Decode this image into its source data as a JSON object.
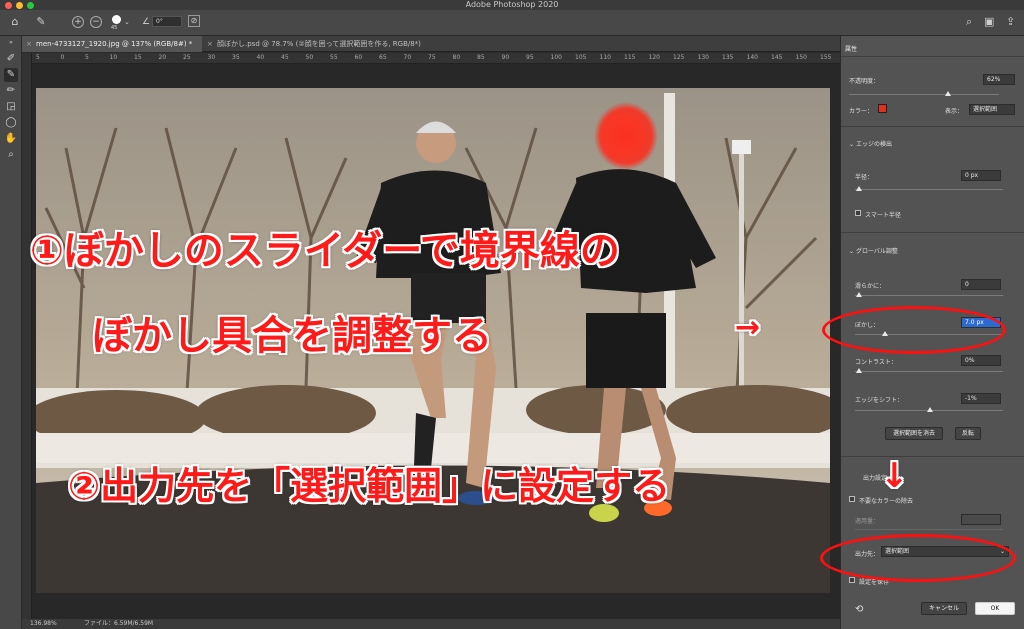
{
  "window": {
    "title": "Adobe Photoshop 2020"
  },
  "colors": {
    "accent_red": "#ff1a1a",
    "mask_red": "#e03020",
    "selection_blue": "#2b6ad0"
  },
  "options_bar": {
    "brush_size": "45",
    "angle": "0°"
  },
  "tabs": [
    {
      "label": "men-4733127_1920.jpg @ 137% (RGB/8#) *",
      "active": true
    },
    {
      "label": "顔ぼかし.psd @ 78.7% (②顔を囲って選択範囲を作る, RGB/8*)",
      "active": false
    }
  ],
  "ruler": {
    "ticks": [
      "5",
      "0",
      "5",
      "10",
      "15",
      "20",
      "25",
      "30",
      "35",
      "40",
      "45",
      "50",
      "55",
      "60",
      "65",
      "70",
      "75",
      "80",
      "85",
      "90",
      "95",
      "100",
      "105",
      "110",
      "115",
      "120",
      "125",
      "130",
      "135",
      "140",
      "145",
      "150",
      "155"
    ]
  },
  "status": {
    "zoom": "136.98%",
    "file": "ファイル：6.59M/6.59M"
  },
  "properties": {
    "tab": "属性",
    "opacity_label": "不透明度：",
    "opacity_value": "62%",
    "color_label": "カラー：",
    "view_label": "表示：",
    "view_value": "選択範囲",
    "edge_section": "エッジの検出",
    "radius_label": "半径：",
    "radius_value": "0 px",
    "smart_radius": "スマート半径",
    "global_section": "グローバル調整",
    "smooth_label": "滑らかに：",
    "smooth_value": "0",
    "feather_label": "ぼかし：",
    "feather_value": "7.0 px",
    "feather_fraction": 0.2,
    "contrast_label": "コントラスト：",
    "contrast_value": "0%",
    "shift_label": "エッジをシフト：",
    "shift_value": "-1%",
    "shift_fraction": 0.5,
    "clear_btn": "選択範囲を消去",
    "invert_btn": "反転",
    "output_section": "出力設定",
    "decontam": "不要なカラーの除去",
    "amount_label": "適用量：",
    "output_label": "出力先：",
    "output_value": "選択範囲",
    "remember": "設定を保存",
    "cancel": "キャンセル",
    "ok": "OK"
  },
  "annotations": {
    "line1": "①ぼかしのスライダーで境界線の",
    "line2": "ぼかし具合を調整する",
    "arrow_right": "→",
    "line3": "②出力先を「選択範囲」に設定する",
    "arrow_down": "↓"
  }
}
